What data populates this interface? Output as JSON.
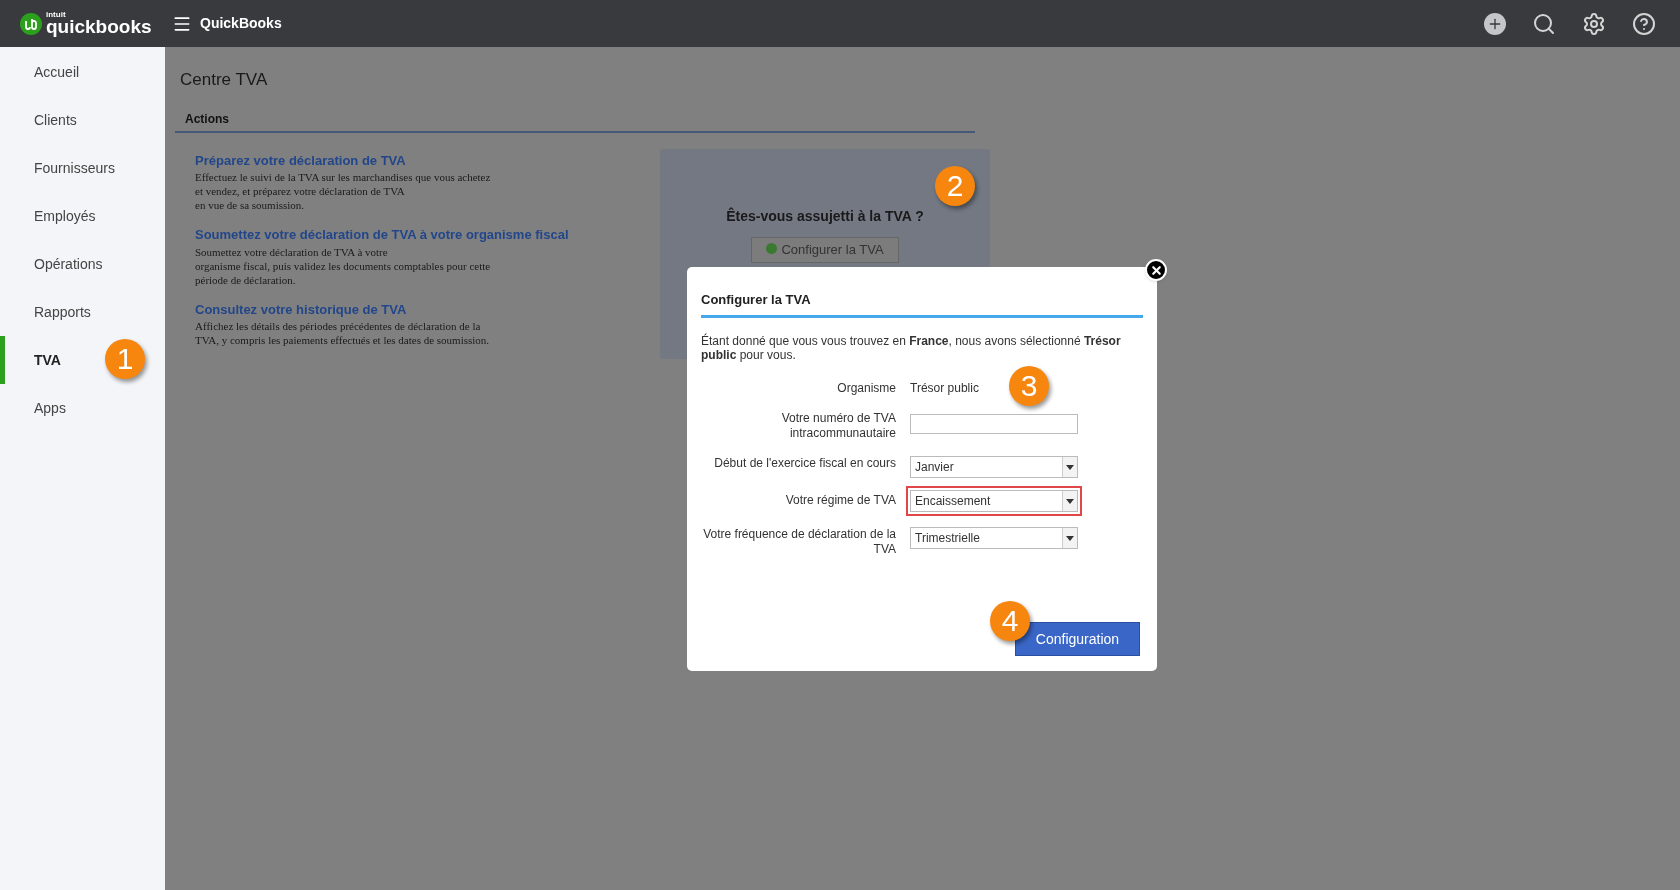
{
  "topbar": {
    "logo_small": "intuit",
    "logo": "quickbooks",
    "title": "QuickBooks"
  },
  "sidebar": {
    "items": [
      {
        "label": "Accueil",
        "selected": false
      },
      {
        "label": "Clients",
        "selected": false
      },
      {
        "label": "Fournisseurs",
        "selected": false
      },
      {
        "label": "Employés",
        "selected": false
      },
      {
        "label": "Opérations",
        "selected": false
      },
      {
        "label": "Rapports",
        "selected": false
      },
      {
        "label": "TVA",
        "selected": true
      },
      {
        "label": "Apps",
        "selected": false
      }
    ]
  },
  "page": {
    "title": "Centre TVA",
    "section": "Actions",
    "actions": [
      {
        "title": "Préparez votre déclaration de TVA",
        "lines": [
          "Effectuez le suivi de la TVA sur les marchandises que vous achetez",
          "et vendez, et préparez votre déclaration de TVA",
          "en vue de sa soumission."
        ]
      },
      {
        "title": "Soumettez votre déclaration de TVA à votre organisme fiscal",
        "lines": [
          "Soumettez votre déclaration de TVA à votre",
          "organisme fiscal, puis validez les documents comptables pour cette",
          "période de déclaration."
        ]
      },
      {
        "title": "Consultez votre historique de TVA",
        "lines": [
          "Affichez les détails des périodes précédentes de déclaration de la",
          "TVA, y compris les paiements effectués et les dates de soumission."
        ]
      }
    ],
    "card": {
      "question": "Êtes-vous assujetti à la TVA ?",
      "button": "Configurer la TVA"
    }
  },
  "dialog": {
    "title": "Configurer la TVA",
    "intro": "Étant donné que vous vous trouvez en **France**, nous avons sélectionné **Trésor public** pour vous.",
    "fields": [
      {
        "kind": "text",
        "label": "Organisme",
        "value": "Trésor public",
        "highlighted": false
      },
      {
        "kind": "input",
        "label": "Votre numéro de TVA intracommunautaire",
        "highlighted": false
      },
      {
        "kind": "select",
        "label": "Début de l'exercice fiscal en cours",
        "value": "Janvier",
        "highlighted": false
      },
      {
        "kind": "select",
        "label": "Votre régime de TVA",
        "value": "Encaissement",
        "highlighted": true
      },
      {
        "kind": "select",
        "label": "Votre fréquence de déclaration de la TVA",
        "value": "Trimestrielle",
        "highlighted": false
      }
    ],
    "button": "Configuration"
  },
  "callouts": [
    "1",
    "2",
    "3",
    "4"
  ]
}
